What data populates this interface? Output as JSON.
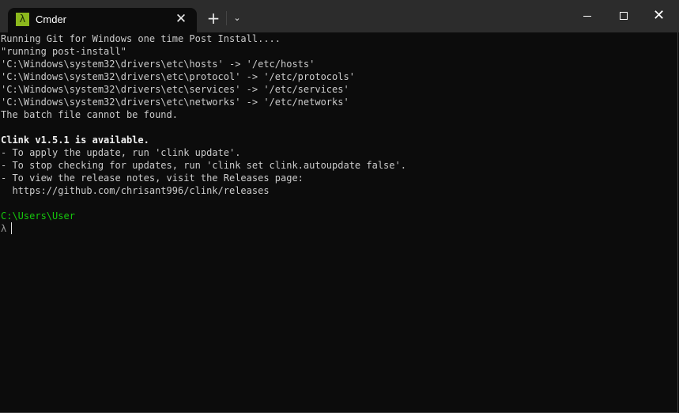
{
  "window": {
    "tab_title": "Cmder",
    "tab_icon": "lambda-icon",
    "tab_icon_glyph": "λ",
    "tab_close_glyph": "✕",
    "new_tab_glyph": "+",
    "dropdown_glyph": "⌵",
    "close_glyph": "✕",
    "colors": {
      "titlebar": "#2c2c2c",
      "terminal_bg": "#0c0c0c",
      "icon_green": "#8cb81d",
      "prompt_path": "#16c60c"
    }
  },
  "terminal": {
    "lines": [
      "Running Git for Windows one time Post Install....",
      "\"running post-install\"",
      "'C:\\Windows\\system32\\drivers\\etc\\hosts' -> '/etc/hosts'",
      "'C:\\Windows\\system32\\drivers\\etc\\protocol' -> '/etc/protocols'",
      "'C:\\Windows\\system32\\drivers\\etc\\services' -> '/etc/services'",
      "'C:\\Windows\\system32\\drivers\\etc\\networks' -> '/etc/networks'",
      "The batch file cannot be found.",
      "",
      "Clink v1.5.1 is available.",
      "- To apply the update, run 'clink update'.",
      "- To stop checking for updates, run 'clink set clink.autoupdate false'.",
      "- To view the release notes, visit the Releases page:",
      "  https://github.com/chrisant996/clink/releases",
      ""
    ],
    "prompt_path": "C:\\Users\\User",
    "prompt_symbol": "λ",
    "input": ""
  }
}
